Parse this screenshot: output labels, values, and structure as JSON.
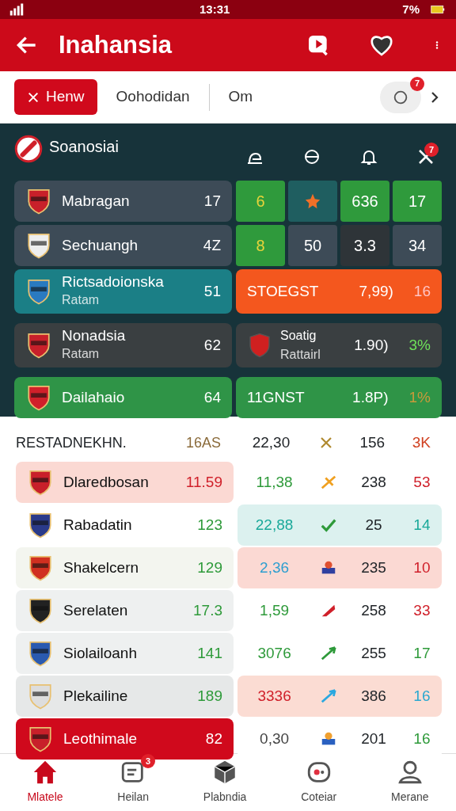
{
  "status_bar": {
    "time": "13:31",
    "battery": "7%"
  },
  "app_bar": {
    "title": "Inahansia"
  },
  "filters": {
    "chips": [
      {
        "label": "Henw",
        "selected": true
      },
      {
        "label": "Oohodidan",
        "selected": false
      },
      {
        "label": "Om",
        "selected": false
      }
    ],
    "badge": "7"
  },
  "featured": {
    "title": "Soanosiai",
    "badge": "7",
    "rows": [
      {
        "kind": "cells",
        "name": "Mabragan",
        "value": "17",
        "color": "#3d4b57",
        "cells": [
          {
            "color": "#2f9a3c",
            "label": {
              "text": "6",
              "color": "#e8d43a"
            }
          },
          {
            "kind": "icon",
            "color": "#1f5e60"
          },
          {
            "color": "#2f9a3c",
            "label": {
              "text": "636"
            }
          },
          {
            "color": "#2f9a3c",
            "label": {
              "text": "17"
            }
          }
        ]
      },
      {
        "kind": "cells",
        "name": "Sechuangh",
        "value": "4Z",
        "color": "#3d4b57",
        "cells": [
          {
            "color": "#2f9a3c",
            "label": {
              "text": "8",
              "color": "#e8d43a"
            }
          },
          {
            "color": "#3d4b57",
            "label": {
              "text": "50"
            }
          },
          {
            "color": "#2e3438",
            "label": {
              "text": "3.3"
            }
          },
          {
            "color": "#3d4b57",
            "label": {
              "text": "34"
            }
          }
        ]
      },
      {
        "kind": "card",
        "name": "Rictsadoionska",
        "sub": "Ratam",
        "value": "51",
        "color": "#1b7f86",
        "right": {
          "color": "#f4571e",
          "label": "STOEGST",
          "odds": "7,99)",
          "pct": {
            "text": "16",
            "color": "#ffc4c4"
          }
        }
      },
      {
        "kind": "card",
        "name": "Nonadsia",
        "sub": "Ratam",
        "value": "62",
        "color": "#3a3f41",
        "right": {
          "color": "#3a3f41",
          "emblem": true,
          "label": "Soatig",
          "sub": "Rattairl",
          "odds": "1.90)",
          "pct": {
            "text": "3%",
            "color": "#6ee05a"
          }
        }
      },
      {
        "kind": "card",
        "name": "Dailahaio",
        "value": "64",
        "color": "#2f9447",
        "right": {
          "color": "#2f9447",
          "label": "11GNST",
          "odds": "1.8P)",
          "pct": {
            "text": "1%",
            "color": "#c89a3a"
          }
        }
      }
    ]
  },
  "table": {
    "header": [
      "RESTADNEKHN.",
      "16AS",
      "22,30",
      "156",
      "3K"
    ],
    "rows": [
      {
        "name": "Dlaredbosan",
        "color": "#fbd9d3",
        "value": {
          "text": "11.59",
          "color": "#d0202a"
        },
        "right": {
          "color": "#ffffff",
          "v1": {
            "text": "11,38",
            "color": "#2e9a3a"
          },
          "v2": "238",
          "v3": {
            "text": "53",
            "color": "#d0202a"
          }
        }
      },
      {
        "name": "Rabadatin",
        "color": "#ffffff",
        "value": {
          "text": "123",
          "color": "#2e9a3a"
        },
        "right": {
          "color": "#dcf1ef",
          "v1": {
            "text": "22,88",
            "color": "#1aa99a"
          },
          "v2": "25",
          "v3": {
            "text": "14",
            "color": "#1aa99a"
          }
        }
      },
      {
        "name": "Shakelcern",
        "color": "#f3f5ef",
        "value": {
          "text": "129",
          "color": "#2e9a3a"
        },
        "right": {
          "color": "#fbd9d3",
          "v1": {
            "text": "2,36",
            "color": "#2e9fd0"
          },
          "v2": "235",
          "v3": {
            "text": "10",
            "color": "#d0202a"
          }
        }
      },
      {
        "name": "Serelaten",
        "color": "#eef0f0",
        "value": {
          "text": "17.3",
          "color": "#2e9a3a"
        },
        "right": {
          "color": "#ffffff",
          "v1": {
            "text": "1,59",
            "color": "#2e9a3a"
          },
          "v2": "258",
          "v3": {
            "text": "33",
            "color": "#d0202a"
          }
        }
      },
      {
        "name": "Siolailoanh",
        "color": "#eef0f0",
        "value": {
          "text": "141",
          "color": "#2e9a3a"
        },
        "right": {
          "color": "#ffffff",
          "v1": {
            "text": "3076",
            "color": "#2e9a3a"
          },
          "v2": "255",
          "v3": {
            "text": "17",
            "color": "#2e9a3a"
          }
        }
      },
      {
        "name": "Plekailine",
        "color": "#e6e8e8",
        "value": {
          "text": "189",
          "color": "#2e9a3a"
        },
        "right": {
          "color": "#fbdcd3",
          "v1": {
            "text": "3336",
            "color": "#d0202a"
          },
          "v2": "386",
          "v3": {
            "text": "16",
            "color": "#2aa8d0"
          }
        }
      },
      {
        "name": "Leothimale",
        "color": "#d0091c",
        "value": {
          "text": "82",
          "color": "#ffffff"
        },
        "right": {
          "color": "#ffffff",
          "v1": {
            "text": "0,30",
            "color": "#444444"
          },
          "v2": "201",
          "v3": {
            "text": "16",
            "color": "#2e9a3a"
          }
        }
      }
    ]
  },
  "bottom_nav": [
    {
      "label": "Mlatele",
      "selected": true
    },
    {
      "label": "Heilan",
      "selected": false,
      "badge": "3"
    },
    {
      "label": "Plabndia",
      "selected": false
    },
    {
      "label": "Coteiar",
      "selected": false
    },
    {
      "label": "Merane",
      "selected": false
    }
  ]
}
